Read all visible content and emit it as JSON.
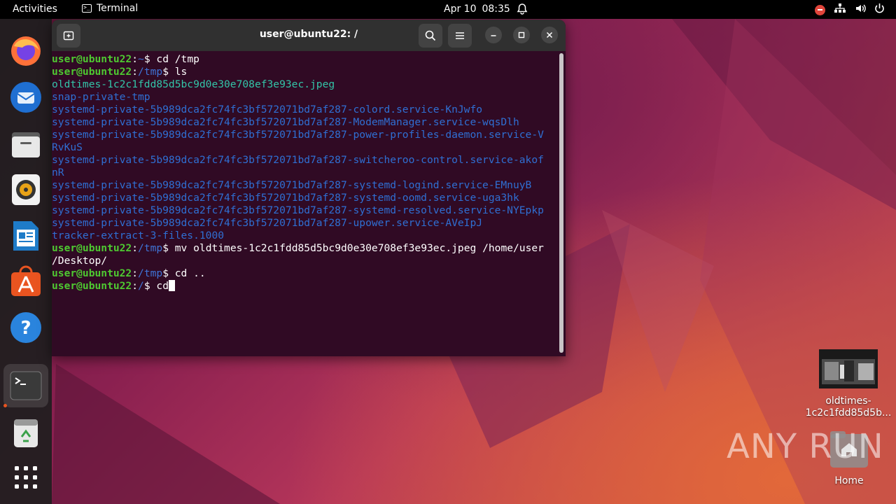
{
  "topbar": {
    "activities": "Activities",
    "app_name": "Terminal",
    "date": "Apr 10",
    "time": "08:35"
  },
  "dock": {
    "items": [
      "firefox-icon",
      "thunderbird-icon",
      "files-icon",
      "rhythmbox-icon",
      "libreoffice-writer-icon",
      "app-center-icon",
      "help-icon",
      "terminal-icon",
      "trash-icon",
      "show-apps-icon"
    ]
  },
  "terminal": {
    "title": "user@ubuntu22: /",
    "prompt_user": "user@ubuntu22",
    "lines": [
      {
        "user": "user@ubuntu22",
        "path": "~",
        "cmd": " cd /tmp"
      },
      {
        "user": "user@ubuntu22",
        "path": "/tmp",
        "cmd": " ls"
      }
    ],
    "ls_file": "oldtimes-1c2c1fdd85d5bc9d0e30e708ef3e93ec.jpeg",
    "ls_dirs": [
      "snap-private-tmp",
      "systemd-private-5b989dca2fc74fc3bf572071bd7af287-colord.service-KnJwfo",
      "systemd-private-5b989dca2fc74fc3bf572071bd7af287-ModemManager.service-wqsDlh",
      "systemd-private-5b989dca2fc74fc3bf572071bd7af287-power-profiles-daemon.service-V",
      "RvKuS",
      "systemd-private-5b989dca2fc74fc3bf572071bd7af287-switcheroo-control.service-akof",
      "nR",
      "systemd-private-5b989dca2fc74fc3bf572071bd7af287-systemd-logind.service-EMnuyB",
      "systemd-private-5b989dca2fc74fc3bf572071bd7af287-systemd-oomd.service-uga3hk",
      "systemd-private-5b989dca2fc74fc3bf572071bd7af287-systemd-resolved.service-NYEpkp",
      "systemd-private-5b989dca2fc74fc3bf572071bd7af287-upower.service-AVeIpJ",
      "tracker-extract-3-files.1000"
    ],
    "mv_cmd": " mv oldtimes-1c2c1fdd85d5bc9d0e30e708ef3e93ec.jpeg /home/user",
    "mv_cont": "/Desktop/",
    "cd_up": {
      "path": "/tmp",
      "cmd": " cd .."
    },
    "current": {
      "path": "/",
      "cmd": " cd"
    },
    "dollar": "$",
    "colon": ":"
  },
  "desktop": {
    "file_label_1": "oldtimes-",
    "file_label_2": "1c2c1fdd85d5b...",
    "home_label": "Home"
  },
  "watermark": "ANY  RUN"
}
